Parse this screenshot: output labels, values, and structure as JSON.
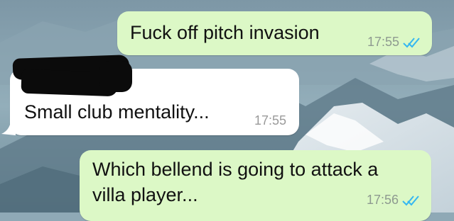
{
  "colors": {
    "outgoing_bubble": "#dcf8c6",
    "incoming_bubble": "#ffffff",
    "read_tick": "#34b7f1",
    "sender_name": "#1b9b37"
  },
  "messages": [
    {
      "direction": "outgoing",
      "text": "Fuck off pitch invasion",
      "time": "17:55",
      "status_icon": "double-tick-read-icon"
    },
    {
      "direction": "incoming",
      "sender_redacted": true,
      "text": "Small club mentality...",
      "time": "17:55"
    },
    {
      "direction": "outgoing",
      "text_lines": [
        "Which bellend is going to attack a",
        "villa player..."
      ],
      "time": "17:56",
      "status_icon": "double-tick-read-icon"
    }
  ]
}
